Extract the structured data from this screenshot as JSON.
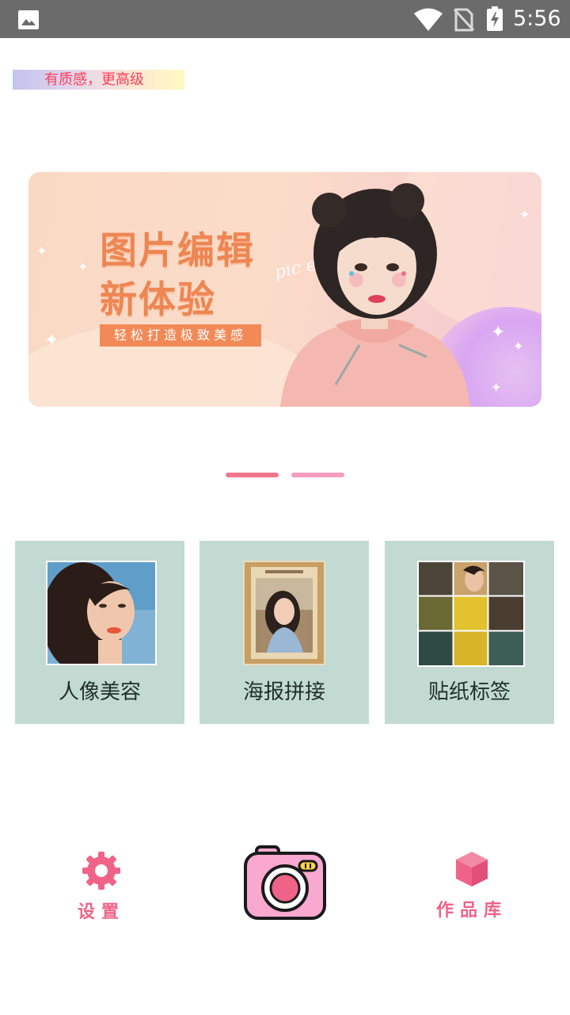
{
  "status_bar": {
    "time": "5:56",
    "icons": [
      "image-notification-icon",
      "wifi-icon",
      "no-sim-icon",
      "battery-charging-icon"
    ]
  },
  "tagline": "有质感，更高级",
  "banner": {
    "title_line1": "图片编辑",
    "title_line2": "新体验",
    "subtitle": "轻松打造极致美感",
    "script_text": "pic editor"
  },
  "carousel": {
    "page_count": 2,
    "active_index": 0
  },
  "features": [
    {
      "label": "人像美容",
      "icon": "portrait-beauty-thumbnail"
    },
    {
      "label": "海报拼接",
      "icon": "poster-collage-thumbnail"
    },
    {
      "label": "贴纸标签",
      "icon": "sticker-grid-thumbnail"
    }
  ],
  "bottom_nav": {
    "settings_label": "设置",
    "camera": "camera-icon",
    "gallery_label": "作品库"
  },
  "colors": {
    "accent_pink": "#f06389",
    "card_bg": "#c3dad2",
    "banner_orange": "#ee8653",
    "status_bar_bg": "#6b6b6b"
  }
}
